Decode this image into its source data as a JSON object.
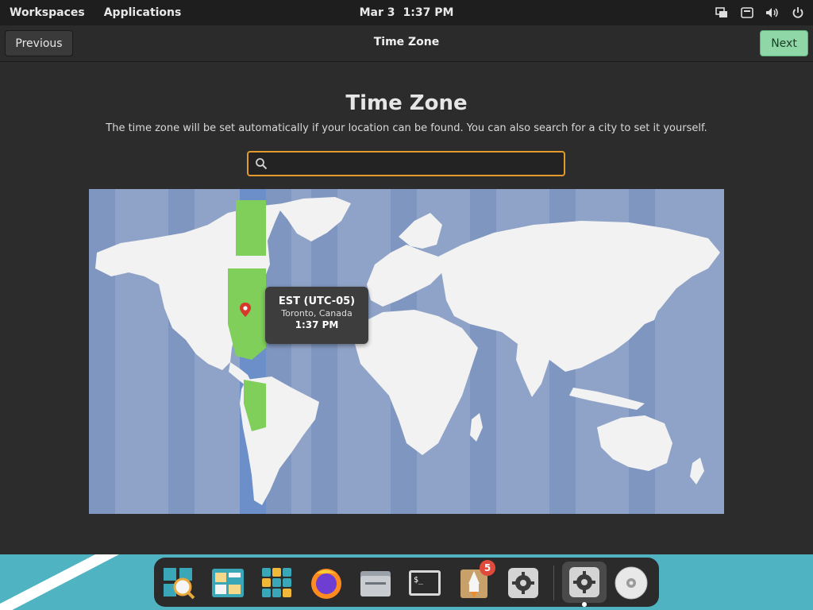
{
  "topbar": {
    "workspaces": "Workspaces",
    "applications": "Applications",
    "date": "Mar 3",
    "time": "1:37 PM",
    "tray_icons": [
      "network-icon",
      "keyboard-icon",
      "volume-icon",
      "power-icon"
    ]
  },
  "header": {
    "previous_label": "Previous",
    "title": "Time Zone",
    "next_label": "Next"
  },
  "main": {
    "title": "Time Zone",
    "description": "The time zone will be set automatically if your location can be found. You can also search for a city to set it yourself.",
    "search": {
      "value": "",
      "placeholder": ""
    }
  },
  "map": {
    "selected_zone": "EST (UTC-05)",
    "location": "Toronto, Canada",
    "local_time": "1:37 PM",
    "ocean_color": "#8fa3c8",
    "highlight_color": "#7fcf5a",
    "land_color": "#f2f2f2"
  },
  "dock": {
    "apps": [
      "AppCenter search",
      "Tasks",
      "Apps grid",
      "Firefox",
      "Files",
      "Terminal",
      "Launcher",
      "Settings",
      "System Settings",
      "Disks"
    ],
    "badge_count": "5"
  },
  "colors": {
    "accent": "#e29a2b",
    "next_button": "#8fd7a6",
    "panel": "#1e1e1e",
    "window": "#2c2c2c"
  }
}
